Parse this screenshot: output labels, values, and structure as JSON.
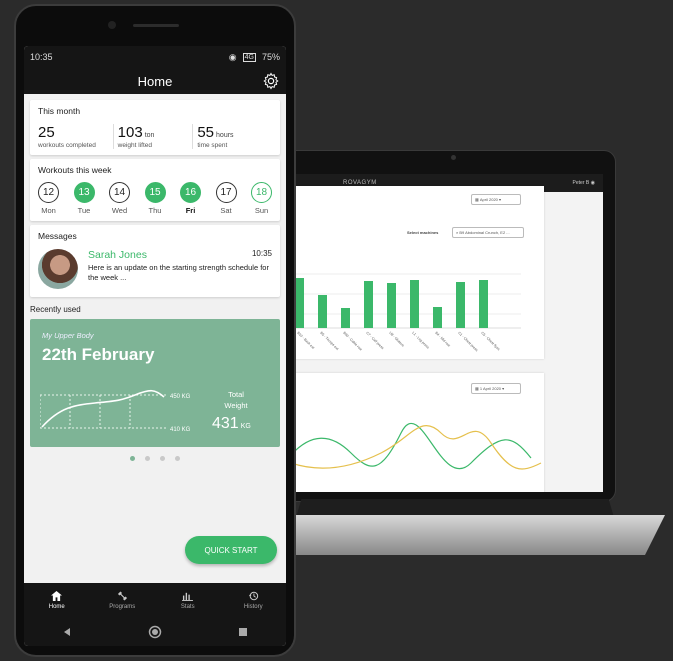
{
  "phone": {
    "status": {
      "time": "10:35",
      "network": "4G",
      "battery": "75%"
    },
    "appbar": {
      "title": "Home"
    },
    "this_month": {
      "title": "This month",
      "stats": [
        {
          "value": "25",
          "unit": "",
          "label": "workouts completed"
        },
        {
          "value": "103",
          "unit": "ton",
          "label": "weight lifted"
        },
        {
          "value": "55",
          "unit": "hours",
          "label": "time spent"
        }
      ]
    },
    "week": {
      "title": "Workouts this week",
      "days": [
        {
          "num": "12",
          "label": "Mon",
          "state": "open"
        },
        {
          "num": "13",
          "label": "Tue",
          "state": "done"
        },
        {
          "num": "14",
          "label": "Wed",
          "state": "open"
        },
        {
          "num": "15",
          "label": "Thu",
          "state": "done"
        },
        {
          "num": "16",
          "label": "Fri",
          "state": "done-today"
        },
        {
          "num": "17",
          "label": "Sat",
          "state": "open"
        },
        {
          "num": "18",
          "label": "Sun",
          "state": "ring"
        }
      ]
    },
    "messages": {
      "title": "Messages",
      "sender": "Sarah Jones",
      "time": "10:35",
      "text": "Here is an update on the starting strength schedule for the week ..."
    },
    "recent": {
      "section_label": "Recently used",
      "subtitle": "My Upper Body",
      "date": "22th February",
      "high_label": "450 KG",
      "low_label": "410 KG",
      "total_label": "Total Weight",
      "total_value": "431",
      "total_unit": "KG",
      "page_dots": 4,
      "active_dot": 0
    },
    "quick_start": "QUICK START",
    "nav": [
      {
        "label": "Home",
        "icon": "home-icon",
        "active": true
      },
      {
        "label": "Programs",
        "icon": "dumbbell-icon",
        "active": false
      },
      {
        "label": "Stats",
        "icon": "bar-chart-icon",
        "active": false
      },
      {
        "label": "History",
        "icon": "history-icon",
        "active": false
      }
    ]
  },
  "laptop": {
    "brand": "ROVAGYM",
    "user": "Peter B",
    "card1": {
      "date": "April 2020",
      "select_label": "Select machines",
      "select_value": "B9 Abdominal Crunch, E2 ..."
    },
    "card2": {
      "date": "1 April 2020"
    },
    "bar_labels": [
      "B10 - Back ext",
      "B5 - Triceps ext",
      "B90 - Cable row",
      "C7 - Calf press",
      "U8 - Gluteus",
      "L1 - Leg press",
      "B4 - Mid row",
      "C1 - Chest press",
      "C5 - Chest flyes"
    ],
    "bar_color": "#3bb86a"
  },
  "colors": {
    "accent": "#3bb86a",
    "card_green": "#7eb496",
    "dark": "#151515"
  }
}
